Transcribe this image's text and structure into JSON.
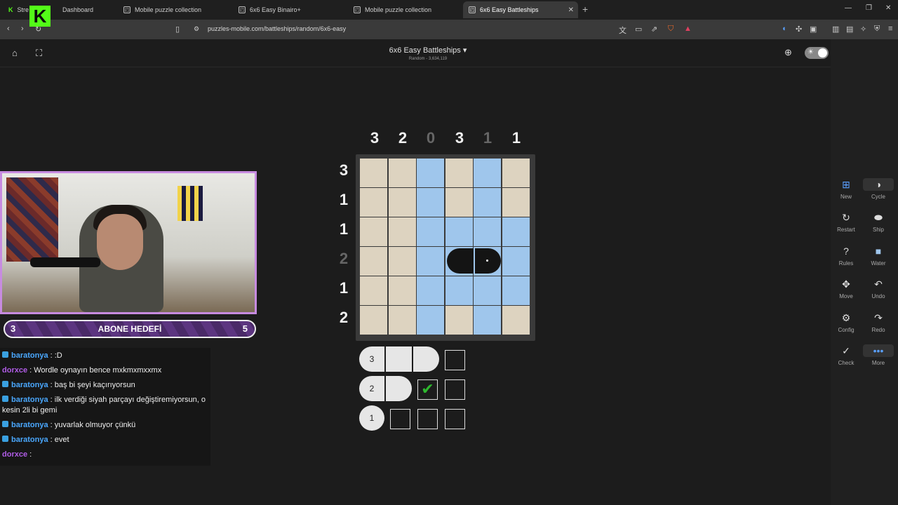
{
  "browser": {
    "tabs": [
      {
        "label": "Stre",
        "extra": "Dashboard"
      },
      {
        "label": "Mobile puzzle collection"
      },
      {
        "label": "6x6 Easy Binairo+"
      },
      {
        "label": "Mobile puzzle collection"
      },
      {
        "label": "6x6 Easy Battleships"
      }
    ],
    "url": "puzzles-mobile.com/battleships/random/6x6-easy"
  },
  "header": {
    "title": "6x6 Easy Battleships ▾",
    "subtitle": "Random - 3,634,119"
  },
  "puzzle": {
    "col_clues": [
      "3",
      "2",
      "0",
      "3",
      "1",
      "1"
    ],
    "row_clues": [
      "3",
      "1",
      "1",
      "2",
      "1",
      "2"
    ],
    "grid": [
      [
        "sand",
        "sand",
        "water",
        "sand",
        "water",
        "sand"
      ],
      [
        "sand",
        "sand",
        "water",
        "sand",
        "water",
        "sand"
      ],
      [
        "sand",
        "sand",
        "water",
        "water",
        "water",
        "water"
      ],
      [
        "sand",
        "sand",
        "water",
        "shipL",
        "shipR",
        "water"
      ],
      [
        "sand",
        "sand",
        "water",
        "water",
        "water",
        "water"
      ],
      [
        "sand",
        "sand",
        "water",
        "sand",
        "water",
        "sand"
      ]
    ],
    "fleet": [
      {
        "size": "3"
      },
      {
        "size": "2"
      },
      {
        "size": "1"
      }
    ],
    "colors": {
      "sand": "#ddd3c0",
      "water": "#9fc6ec",
      "ship": "#141414"
    }
  },
  "tools": {
    "new": "New",
    "cycle": "Cycle",
    "restart": "Restart",
    "ship": "Ship",
    "rules": "Rules",
    "water": "Water",
    "move": "Move",
    "undo": "Undo",
    "config": "Config",
    "redo": "Redo",
    "check": "Check",
    "more": "More"
  },
  "overlay": {
    "goal_label": "ABONE HEDEFİ",
    "goal_current": "3",
    "goal_target": "5"
  },
  "chat": [
    {
      "user": "baratonya",
      "text": ":D",
      "badge": true,
      "color": "#4aa8ff"
    },
    {
      "user": "dorxce",
      "text": "Wordle oynayın bence mxkmxmxxmx",
      "badge": false,
      "color": "#b05ce6"
    },
    {
      "user": "baratonya",
      "text": "baş bi şeyi kaçırıyorsun",
      "badge": true,
      "color": "#4aa8ff"
    },
    {
      "user": "baratonya",
      "text": "ilk verdiği siyah parçayı değiştiremiyorsun, o kesin 2li bi gemi",
      "badge": true,
      "color": "#4aa8ff"
    },
    {
      "user": "baratonya",
      "text": "yuvarlak olmuyor çünkü",
      "badge": true,
      "color": "#4aa8ff"
    },
    {
      "user": "baratonya",
      "text": "evet",
      "badge": true,
      "color": "#4aa8ff"
    },
    {
      "user": "dorxce",
      "text": "",
      "badge": false,
      "color": "#b05ce6"
    }
  ]
}
